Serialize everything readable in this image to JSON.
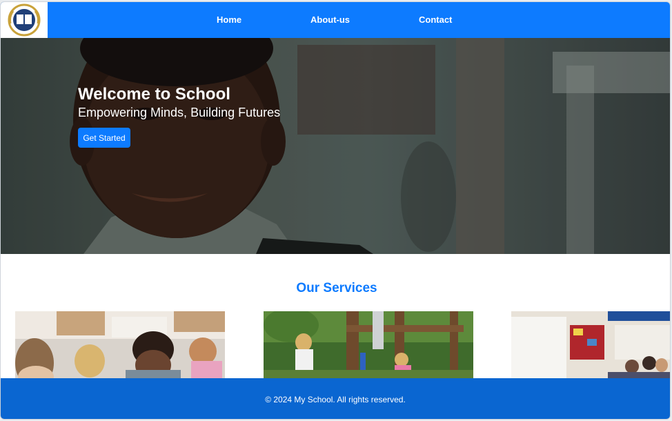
{
  "nav": {
    "logo_name": "school-logo",
    "links": [
      {
        "label": "Home"
      },
      {
        "label": "About-us"
      },
      {
        "label": "Contact"
      }
    ],
    "color": "#0d7bff"
  },
  "hero": {
    "title": "Welcome to School",
    "subtitle": "Empowering Minds, Building Futures",
    "button_label": "Get Started"
  },
  "services": {
    "title": "Our Services",
    "cards": [
      {
        "image": "classroom-children-photo"
      },
      {
        "image": "playground-children-photo"
      },
      {
        "image": "classroom-group-photo"
      }
    ]
  },
  "footer": {
    "text": "© 2024 My School. All rights reserved.",
    "color": "#0a66d1"
  }
}
